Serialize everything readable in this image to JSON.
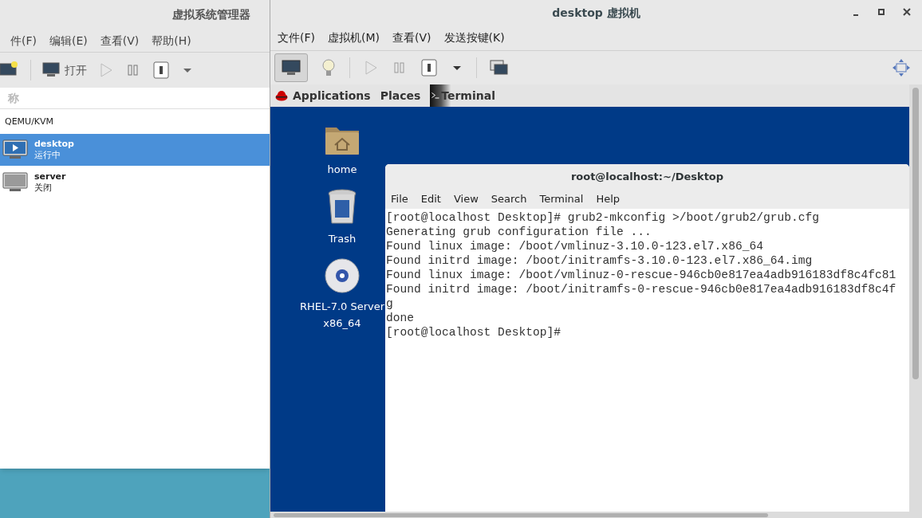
{
  "manager_window": {
    "title": "虚拟系统管理器",
    "menu": [
      "件(F)",
      "编辑(E)",
      "查看(V)",
      "帮助(H)"
    ],
    "open_button": "打开",
    "column_header": "称",
    "connection": "QEMU/KVM",
    "vms": [
      {
        "name": "desktop",
        "status": "运行中",
        "running": true,
        "selected": true
      },
      {
        "name": "server",
        "status": "关闭",
        "running": false,
        "selected": false
      }
    ]
  },
  "viewer_window": {
    "title": "desktop 虚拟机",
    "menu": [
      "文件(F)",
      "虚拟机(M)",
      "查看(V)",
      "发送按键(K)"
    ],
    "guest": {
      "top_bar": {
        "applications": "Applications",
        "places": "Places",
        "task": "Terminal"
      },
      "desktop_icons": [
        {
          "kind": "folder",
          "label": "home"
        },
        {
          "kind": "trash",
          "label": "Trash"
        },
        {
          "kind": "disc",
          "label": "RHEL-7.0 Server x86_64"
        }
      ],
      "terminal": {
        "title": "root@localhost:~/Desktop",
        "menu": [
          "File",
          "Edit",
          "View",
          "Search",
          "Terminal",
          "Help"
        ],
        "lines": [
          "[root@localhost Desktop]# grub2-mkconfig >/boot/grub2/grub.cfg",
          "Generating grub configuration file ...",
          "Found linux image: /boot/vmlinuz-3.10.0-123.el7.x86_64",
          "Found initrd image: /boot/initramfs-3.10.0-123.el7.x86_64.img",
          "Found linux image: /boot/vmlinuz-0-rescue-946cb0e817ea4adb916183df8c4fc81",
          "Found initrd image: /boot/initramfs-0-rescue-946cb0e817ea4adb916183df8c4f",
          "g",
          "done",
          "[root@localhost Desktop]#"
        ]
      }
    }
  }
}
